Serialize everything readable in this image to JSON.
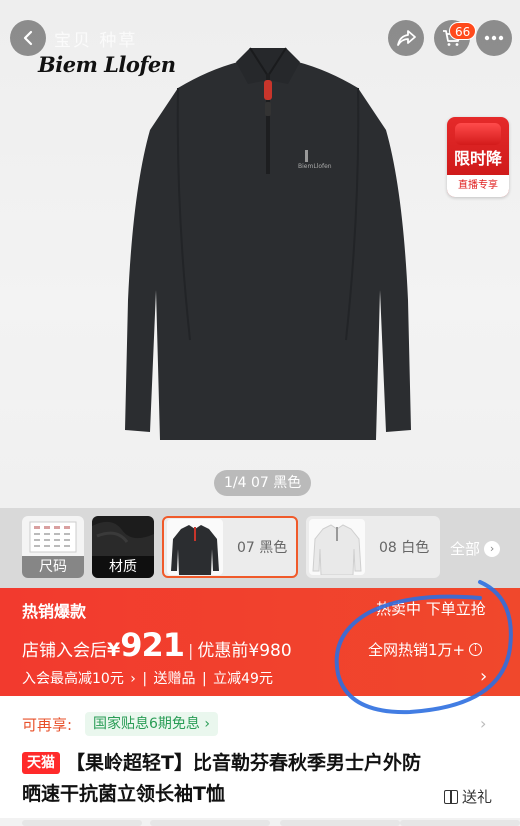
{
  "nav": {
    "title": "宝贝 种草",
    "cart_count": "66"
  },
  "brand": {
    "logo_text": "Biem Llofen"
  },
  "promo_badge": {
    "main": "限时降",
    "sub": "直播专享"
  },
  "gallery": {
    "pager": "1/4 07 黑色"
  },
  "thumbs": {
    "size_chart": "尺码",
    "material": "材质",
    "variants": [
      {
        "label": "07 黑色",
        "selected": true
      },
      {
        "label": "08 白色",
        "selected": false
      }
    ],
    "all": "全部"
  },
  "price": {
    "hot_tag": "热销爆款",
    "hot_right": "热卖中 下单立抢",
    "prefix": "店铺入会后",
    "currency": "¥",
    "amount": "921",
    "separator": "|",
    "original": "优惠前¥980",
    "sold": "全网热销1万+",
    "discounts": [
      "入会最高减10元",
      "|",
      "送赠品",
      "|",
      "立减49元"
    ]
  },
  "subsidy": {
    "label": "可再享:",
    "chip": "国家贴息6期免息"
  },
  "product": {
    "store_tag": "天猫",
    "title_line1": "【果岭超轻T】比音勒芬春秋季男士户外防",
    "title_line2": "晒速干抗菌立领长袖T恤",
    "gift": "送礼"
  },
  "colors": {
    "accent": "#f23a2e",
    "subsidy_green": "#2a9d56",
    "scribble": "#2d6fe0"
  }
}
